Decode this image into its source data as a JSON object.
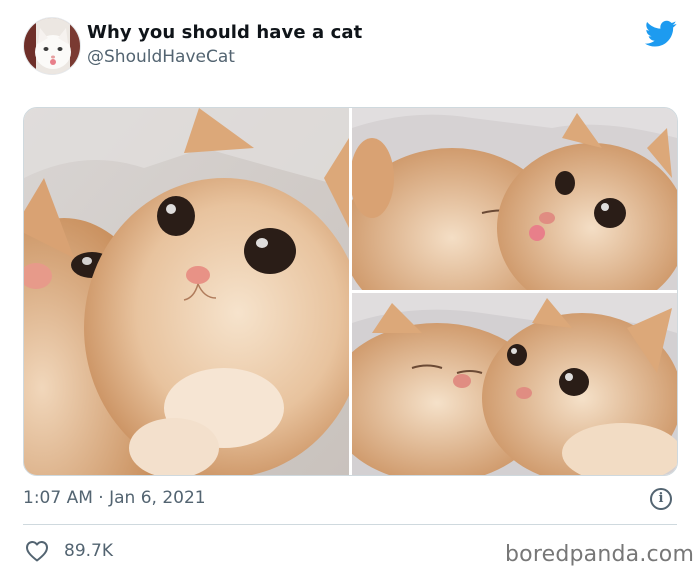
{
  "tweet": {
    "display_name": "Why you should have a cat",
    "handle": "@ShouldHaveCat",
    "timestamp": "1:07 AM · Jan 6, 2021",
    "likes": "89.7K",
    "media": [
      {
        "icon": "cat-photo-icon"
      },
      {
        "icon": "cat-photo-icon"
      },
      {
        "icon": "cat-photo-icon"
      }
    ]
  },
  "colors": {
    "twitter_blue": "#1d9bf0",
    "text_primary": "#0f1419",
    "text_secondary": "#536471",
    "border": "#cfd9de"
  },
  "watermark": {
    "text": "boredpanda.com"
  }
}
